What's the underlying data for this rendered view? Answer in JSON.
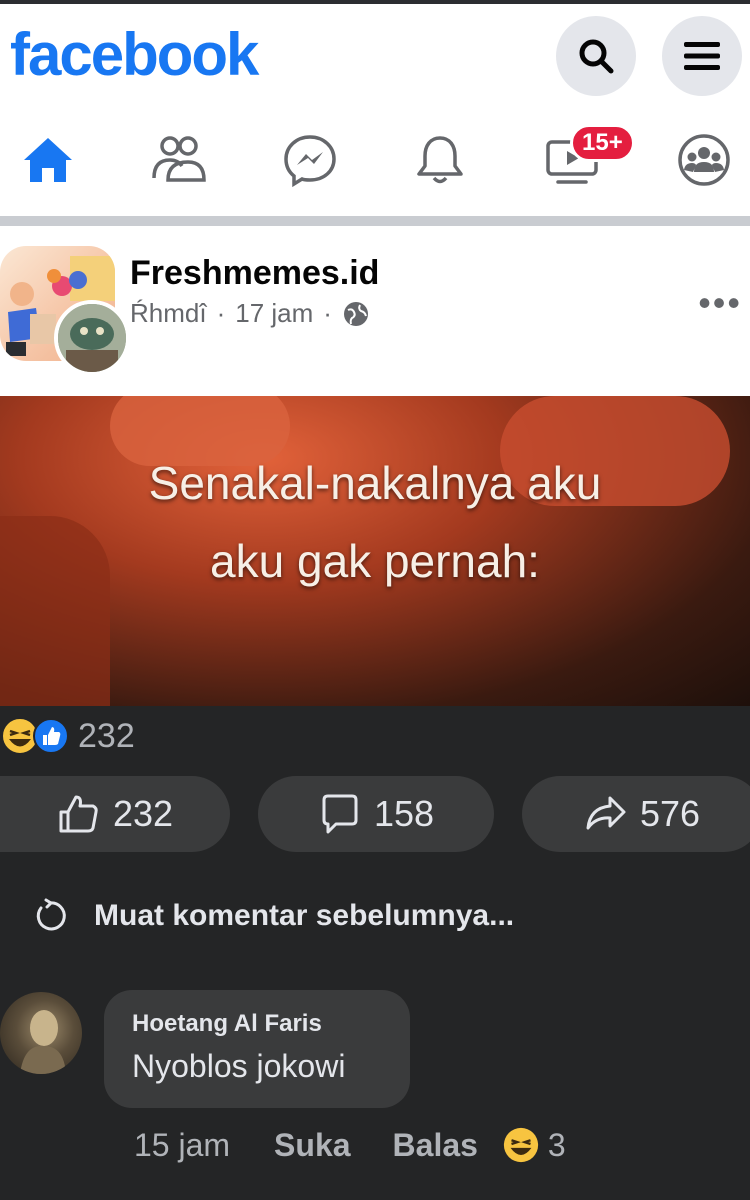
{
  "header": {
    "logo": "facebook"
  },
  "nav": {
    "video_badge": "15+"
  },
  "post": {
    "page_name": "Freshmemes.id",
    "author": "Ŕhmdî",
    "dot1": "·",
    "time": "17 jam",
    "dot2": "·",
    "more": "•••",
    "meme_line1": "Senakal-nakalnya aku",
    "meme_line2": "aku gak pernah:"
  },
  "reactions": {
    "count": "232"
  },
  "actions": {
    "like_count": "232",
    "comment_count": "158",
    "share_count": "576"
  },
  "comments": {
    "load_more": "Muat komentar sebelumnya...",
    "items": [
      {
        "name": "Hoetang Al Faris",
        "text": "Nyoblos jokowi",
        "time": "15 jam",
        "like": "Suka",
        "reply": "Balas",
        "reaction_count": "3"
      }
    ]
  },
  "colors": {
    "brand": "#1877f2",
    "badge": "#e41e3f",
    "dark_bg": "#242526",
    "button_bg": "#3a3b3c"
  }
}
